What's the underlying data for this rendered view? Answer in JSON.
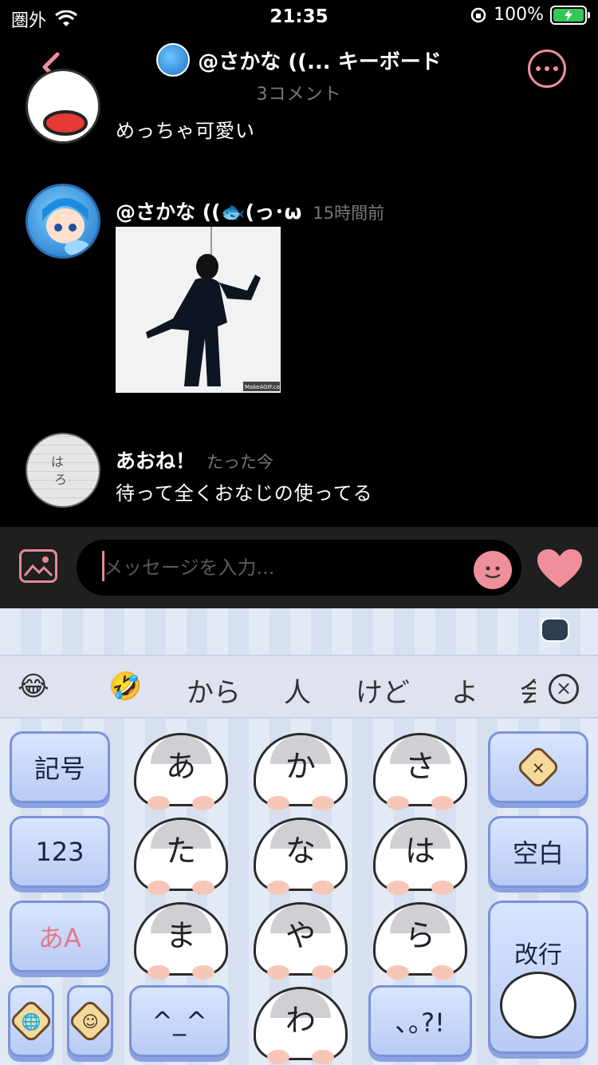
{
  "status_bar": {
    "carrier": "圏外",
    "time": "21:35",
    "battery": "100%"
  },
  "header": {
    "title": "@さかな ((... キーボード",
    "subtitle": "3コメント"
  },
  "comments": [
    {
      "name": "",
      "time": "",
      "text": "めっちゃ可愛い"
    },
    {
      "name": "@さかな ((🐟(っ･ω",
      "time": "15時間前",
      "text": "",
      "image_caption": "MakeAGIF.com"
    },
    {
      "name": "あおね！",
      "time": "たった今",
      "text": "待って全くおなじの使ってる"
    }
  ],
  "input": {
    "placeholder": "メッセージを入力..."
  },
  "keyboard": {
    "suggestions": [
      "😂",
      "🤣",
      "から",
      "人",
      "けど",
      "よ",
      "会"
    ],
    "keys": {
      "symbols": "記号",
      "numbers": "123",
      "kana_toggle": "あA",
      "delete": "×",
      "space": "空白",
      "enter": "改行",
      "emoticon": "^_^",
      "punct": "､｡?!",
      "a": "あ",
      "ka": "か",
      "sa": "さ",
      "ta": "た",
      "na": "な",
      "ha": "は",
      "ma": "ま",
      "ya": "や",
      "ra": "ら",
      "wa": "わ",
      "globe": "🌐",
      "smile": "☺"
    }
  },
  "colors": {
    "accent_pink": "#ef8f9c",
    "keyboard_blue": "#b9cbf4",
    "background": "#000000",
    "input_bar": "#1f1f1f"
  }
}
